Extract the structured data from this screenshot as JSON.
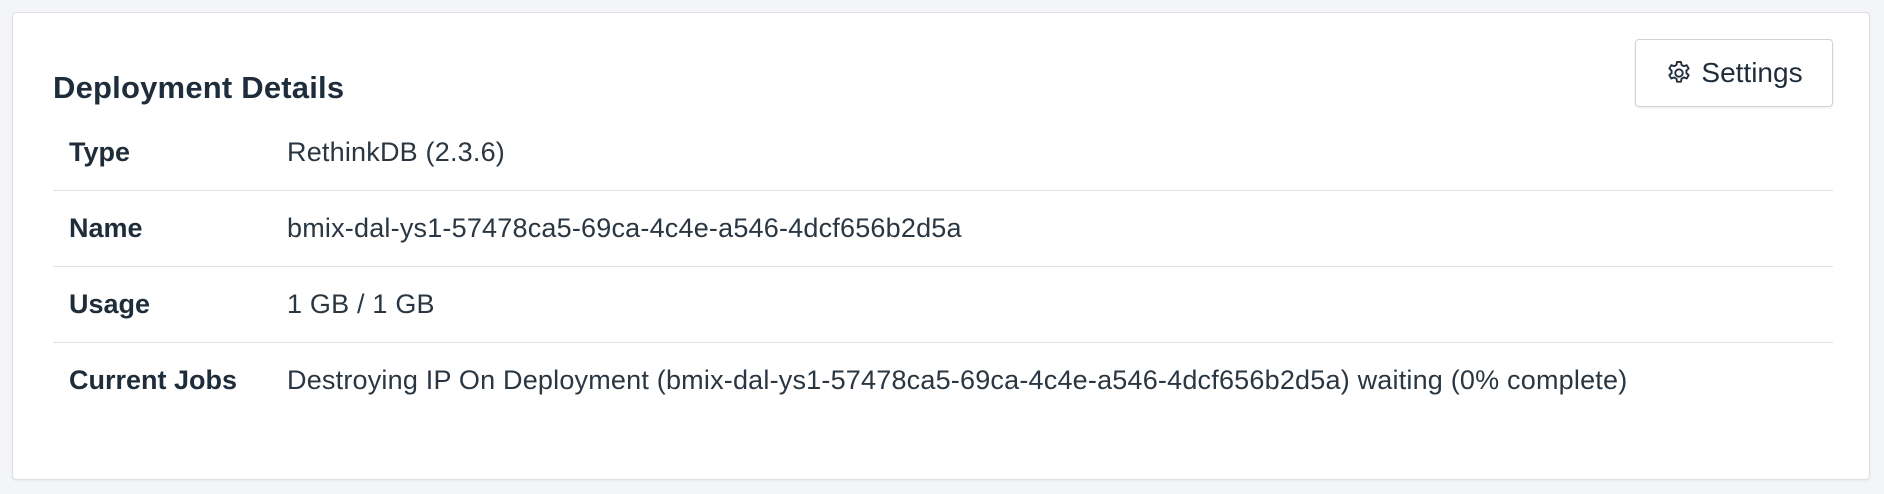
{
  "card": {
    "title": "Deployment Details",
    "settings_label": "Settings",
    "settings_icon": "gear-icon"
  },
  "details": [
    {
      "label": "Type",
      "value": "RethinkDB (2.3.6)"
    },
    {
      "label": "Name",
      "value": "bmix-dal-ys1-57478ca5-69ca-4c4e-a546-4dcf656b2d5a"
    },
    {
      "label": "Usage",
      "value": "1 GB / 1 GB"
    },
    {
      "label": "Current Jobs",
      "value": "Destroying IP On Deployment (bmix-dal-ys1-57478ca5-69ca-4c4e-a546-4dcf656b2d5a) waiting (0% complete)"
    }
  ]
}
